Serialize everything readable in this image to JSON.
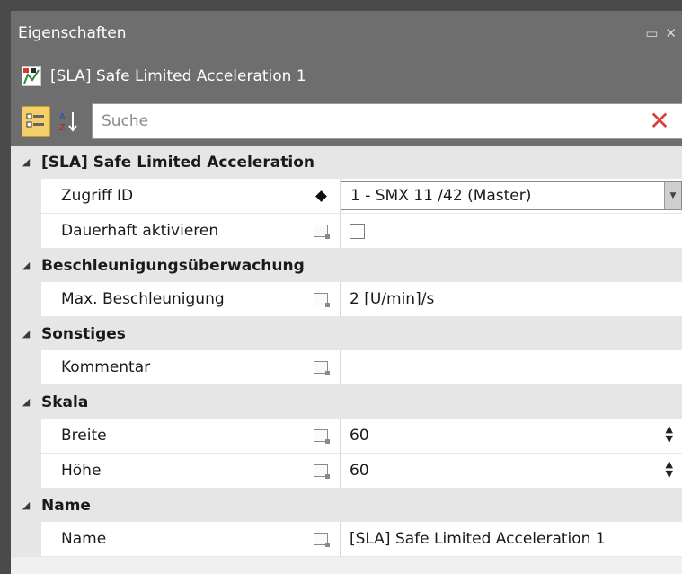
{
  "window": {
    "title": "Eigenschaften",
    "restore_glyph": "▭",
    "close_glyph": "✕"
  },
  "object": {
    "title": "[SLA] Safe Limited Acceleration 1",
    "icon": "sla-object-icon"
  },
  "toolbar": {
    "search_placeholder": "Suche",
    "sort_label": "A Z",
    "clear_glyph": "✕"
  },
  "categories": [
    {
      "title": "[SLA] Safe Limited Acceleration",
      "rows": [
        {
          "name": "Zugriff ID",
          "marker": "diamond",
          "value": "1 - SMX 11 /42 (Master)",
          "editor": "combo"
        },
        {
          "name": "Dauerhaft aktivieren",
          "marker": "edit",
          "value": "",
          "editor": "checkbox"
        }
      ]
    },
    {
      "title": "Beschleunigungsüberwachung",
      "rows": [
        {
          "name": "Max. Beschleunigung",
          "marker": "edit",
          "value": "2 [U/min]/s",
          "editor": "text"
        }
      ]
    },
    {
      "title": "Sonstiges",
      "rows": [
        {
          "name": "Kommentar",
          "marker": "edit",
          "value": "",
          "editor": "text"
        }
      ]
    },
    {
      "title": "Skala",
      "rows": [
        {
          "name": "Breite",
          "marker": "edit",
          "value": "60",
          "editor": "spinner"
        },
        {
          "name": "Höhe",
          "marker": "edit",
          "value": "60",
          "editor": "spinner"
        }
      ]
    },
    {
      "title": "Name",
      "rows": [
        {
          "name": "Name",
          "marker": "edit",
          "value": "[SLA] Safe Limited Acceleration 1",
          "editor": "text"
        }
      ]
    }
  ],
  "colors": {
    "header_bg": "#6e6e6e",
    "category_bg": "#e6e6e6",
    "active_button": "#f4cf6a",
    "clear_red": "#d8413a"
  }
}
